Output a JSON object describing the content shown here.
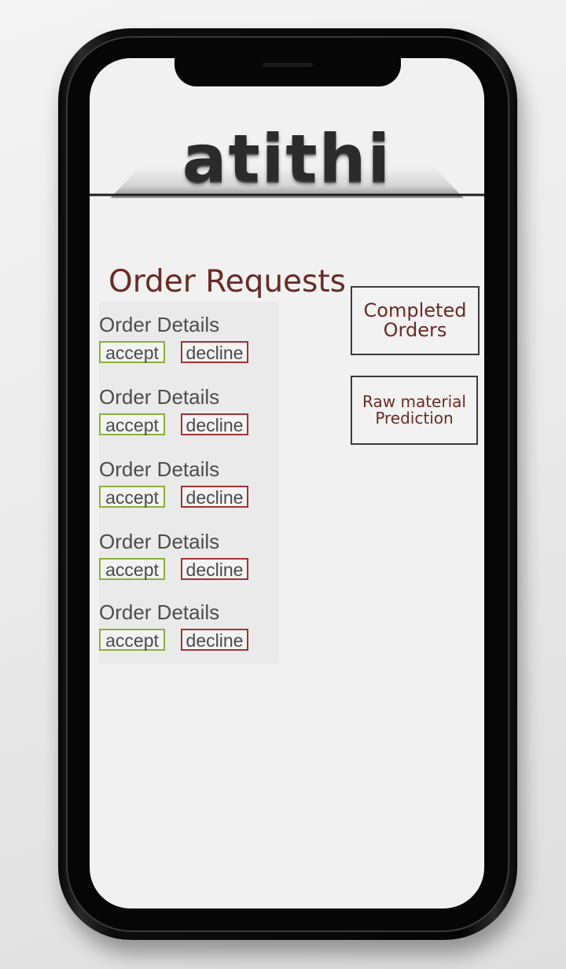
{
  "app": {
    "brand": "atithi"
  },
  "main": {
    "title": "Order Requests",
    "orders": [
      {
        "label": "Order Details",
        "accept": "accept",
        "decline": "decline"
      },
      {
        "label": "Order Details",
        "accept": "accept",
        "decline": "decline"
      },
      {
        "label": "Order Details",
        "accept": "accept",
        "decline": "decline"
      },
      {
        "label": "Order Details",
        "accept": "accept",
        "decline": "decline"
      },
      {
        "label": "Order Details",
        "accept": "accept",
        "decline": "decline"
      }
    ]
  },
  "side": {
    "completed": [
      "Completed",
      "Orders"
    ],
    "prediction": [
      "Raw material",
      "Prediction"
    ]
  },
  "colors": {
    "accent_text": "#6b2a24",
    "accept_border": "#8bb03b",
    "decline_border": "#a33232"
  }
}
